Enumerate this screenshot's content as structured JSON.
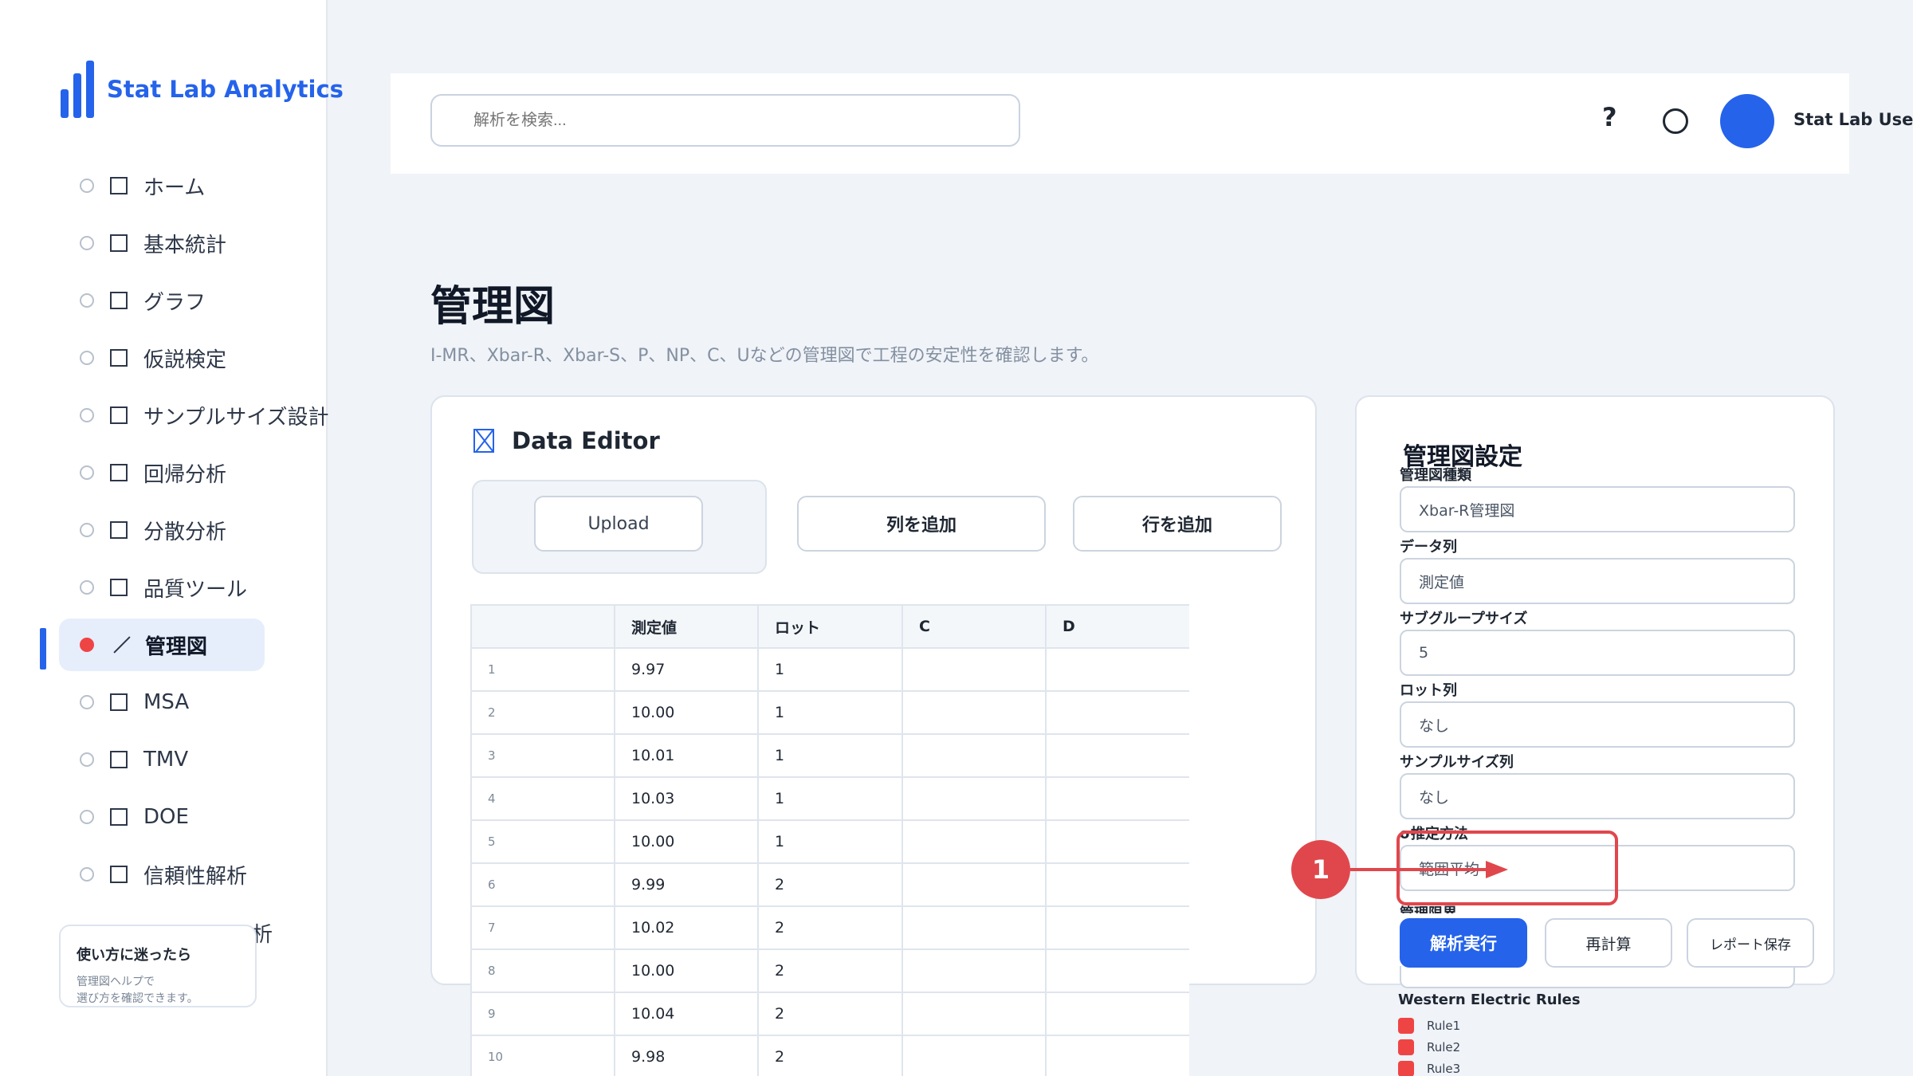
{
  "app": {
    "name": "Stat Lab Analytics",
    "brand_color": "#2563eb"
  },
  "sidebar": {
    "items": [
      {
        "label": "ホーム",
        "icon": "square-icon"
      },
      {
        "label": "基本統計",
        "icon": "square-icon"
      },
      {
        "label": "グラフ",
        "icon": "square-icon"
      },
      {
        "label": "仮説検定",
        "icon": "square-icon"
      },
      {
        "label": "サンプルサイズ設計",
        "icon": "square-icon"
      },
      {
        "label": "回帰分析",
        "icon": "square-icon"
      },
      {
        "label": "分散分析",
        "icon": "square-icon"
      },
      {
        "label": "品質ツール",
        "icon": "square-icon"
      },
      {
        "label": "管理図",
        "icon": "line-chart-icon",
        "active": true
      },
      {
        "label": "MSA",
        "icon": "square-icon"
      },
      {
        "label": "TMV",
        "icon": "square-icon"
      },
      {
        "label": "DOE",
        "icon": "square-icon"
      },
      {
        "label": "信頼性解析",
        "icon": "square-icon"
      }
    ],
    "partial_item_text": "析",
    "help_card": {
      "title": "使い方に迷ったら",
      "line1": "管理図ヘルプで",
      "line2": "選び方を確認できます。"
    }
  },
  "header": {
    "search_placeholder": "解析を検索...",
    "help_glyph": "?",
    "user_name": "Stat Lab User"
  },
  "page": {
    "title": "管理図",
    "description": "I-MR、Xbar-R、Xbar-S、P、NP、C、Uなどの管理図で工程の安定性を確認します。"
  },
  "editor": {
    "title": "Data Editor",
    "upload_label": "Upload",
    "add_column_label": "列を追加",
    "add_row_label": "行を追加",
    "columns": [
      "",
      "測定値",
      "ロット",
      "C",
      "D"
    ],
    "rows": [
      [
        "1",
        "9.97",
        "1",
        "",
        ""
      ],
      [
        "2",
        "10.00",
        "1",
        "",
        ""
      ],
      [
        "3",
        "10.01",
        "1",
        "",
        ""
      ],
      [
        "4",
        "10.03",
        "1",
        "",
        ""
      ],
      [
        "5",
        "10.00",
        "1",
        "",
        ""
      ],
      [
        "6",
        "9.99",
        "2",
        "",
        ""
      ],
      [
        "7",
        "10.02",
        "2",
        "",
        ""
      ],
      [
        "8",
        "10.00",
        "2",
        "",
        ""
      ],
      [
        "9",
        "10.04",
        "2",
        "",
        ""
      ],
      [
        "10",
        "9.98",
        "2",
        "",
        ""
      ]
    ]
  },
  "settings": {
    "title": "管理図設定",
    "fields": [
      {
        "label": "管理図種類",
        "value": "Xbar-R管理図"
      },
      {
        "label": "データ列",
        "value": "測定値"
      },
      {
        "label": "サブグループサイズ",
        "value": "5"
      },
      {
        "label": "ロット列",
        "value": "なし"
      },
      {
        "label": "サンプルサイズ列",
        "value": "なし"
      },
      {
        "label": "σ推定方法",
        "value": "範囲平均"
      }
    ],
    "partial_label": "管理限界",
    "run_label": "解析実行",
    "recalc_label": "再計算",
    "report_label": "レポート保存"
  },
  "rules": {
    "title": "Western Electric Rules",
    "items": [
      "Rule1",
      "Rule2",
      "Rule3"
    ],
    "color": "#ef4444"
  },
  "annotation": {
    "badge": "1",
    "color": "#e0474c"
  }
}
